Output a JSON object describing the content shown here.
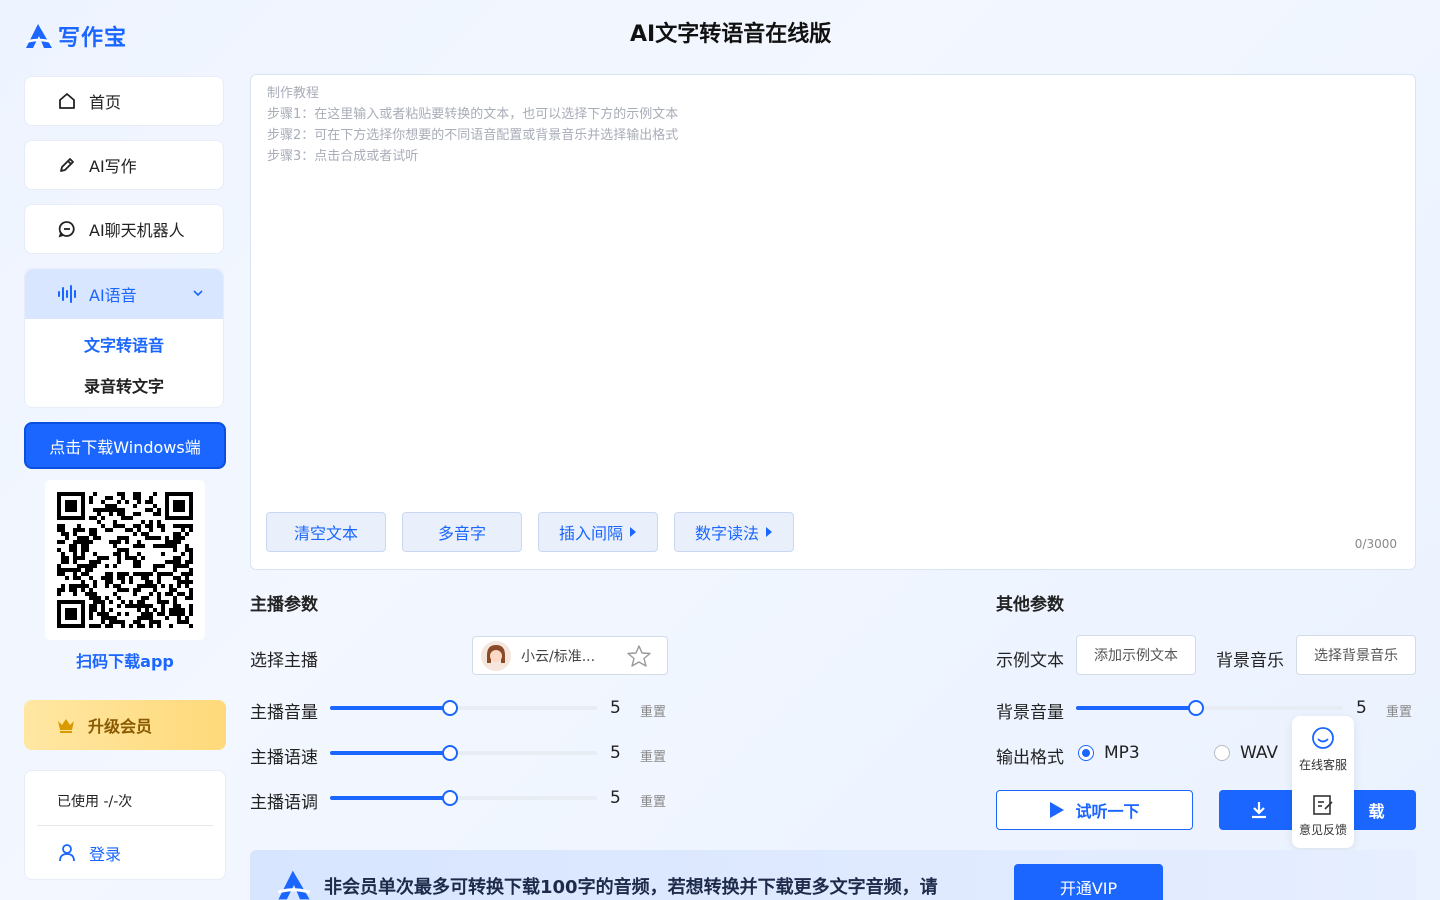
{
  "brand": {
    "name": "写作宝"
  },
  "header": {
    "title": "AI文字转语音在线版"
  },
  "sidebar": {
    "items": [
      {
        "label": "首页"
      },
      {
        "label": "AI写作"
      },
      {
        "label": "AI聊天机器人"
      }
    ],
    "group": {
      "label": "AI语音",
      "sub_items": [
        {
          "label": "文字转语音",
          "active": true
        },
        {
          "label": "录音转文字",
          "active": false
        }
      ]
    },
    "download_windows": "点击下载Windows端",
    "qr_label": "扫码下载app",
    "upgrade": "升级会员",
    "usage": "已使用 -/-次",
    "login": "登录"
  },
  "editor": {
    "placeholder_lines": [
      "制作教程",
      "步骤1：在这里输入或者粘贴要转换的文本，也可以选择下方的示例文本",
      "步骤2：可在下方选择你想要的不同语音配置或背景音乐并选择输出格式",
      "步骤3：点击合成或者试听"
    ],
    "buttons": {
      "clear": "清空文本",
      "polyphone": "多音字",
      "insert_pause": "插入间隔",
      "number_reading": "数字读法"
    },
    "counter": "0/3000"
  },
  "host_params": {
    "title": "主播参数",
    "select_label": "选择主播",
    "host_name": "小云/标准...",
    "volume": {
      "label": "主播音量",
      "value": "5",
      "level": 0.45
    },
    "speed": {
      "label": "主播语速",
      "value": "5",
      "level": 0.45
    },
    "pitch": {
      "label": "主播语调",
      "value": "5",
      "level": 0.45
    },
    "reset": "重置"
  },
  "other_params": {
    "title": "其他参数",
    "example_label": "示例文本",
    "example_btn": "添加示例文本",
    "bgm_label": "背景音乐",
    "bgm_btn": "选择背景音乐",
    "bgm_volume": {
      "label": "背景音量",
      "value": "5",
      "level": 0.45
    },
    "reset": "重置",
    "format_label": "输出格式",
    "formats": [
      {
        "label": "MP3",
        "selected": true
      },
      {
        "label": "WAV",
        "selected": false
      }
    ]
  },
  "actions": {
    "listen": "试听一下",
    "download": "载"
  },
  "float_panel": {
    "service": "在线客服",
    "feedback": "意见反馈"
  },
  "banner": {
    "text": "非会员单次最多可转换下载100字的音频，若想转换并下载更多文字音频，请",
    "button": "开通VIP"
  },
  "colors": {
    "accent": "#1a66ff",
    "vip_gold": "#ffd97a"
  }
}
